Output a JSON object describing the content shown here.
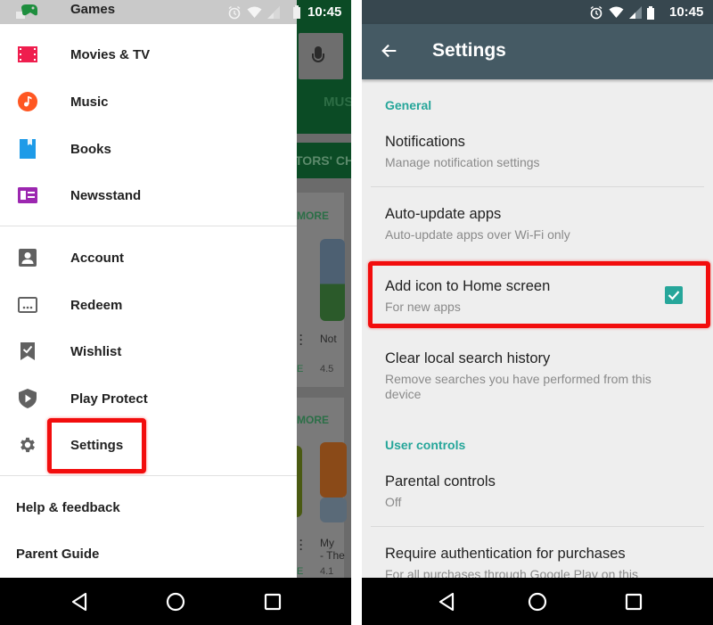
{
  "left_phone": {
    "status_bar": {
      "time": "10:45",
      "icons": [
        "alarm-icon",
        "wifi-icon",
        "signal-icon",
        "battery-icon"
      ]
    },
    "drawer": {
      "partial_item": {
        "label": "Games",
        "icon": "gamepad-icon",
        "icon_color": "#1e8e3e"
      },
      "apps": [
        {
          "label": "Movies & TV",
          "icon": "film-icon",
          "icon_color": "#ef1e4e"
        },
        {
          "label": "Music",
          "icon": "music-note-icon",
          "icon_color": "#ff5722"
        },
        {
          "label": "Books",
          "icon": "book-icon",
          "icon_color": "#1e9be8"
        },
        {
          "label": "Newsstand",
          "icon": "newsstand-icon",
          "icon_color": "#9c27b0"
        }
      ],
      "account_items": [
        {
          "label": "Account",
          "icon": "account-icon"
        },
        {
          "label": "Redeem",
          "icon": "redeem-icon"
        },
        {
          "label": "Wishlist",
          "icon": "wishlist-icon"
        },
        {
          "label": "Play Protect",
          "icon": "shield-play-icon"
        },
        {
          "label": "Settings",
          "icon": "gear-icon",
          "highlighted": true
        }
      ],
      "footer_items": [
        {
          "label": "Help & feedback"
        },
        {
          "label": "Parent Guide"
        }
      ],
      "icon_gray": "#616161"
    },
    "background_app": {
      "tab_partial": "MUS",
      "band_partial": "TORS' CH",
      "more_label": "MORE",
      "card1_title": "Not",
      "card1_rating": "4.5",
      "card1_price_partial": "E",
      "card2_title_line1": "My",
      "card2_title_line2": "- The",
      "card2_rating": "4.1",
      "card2_price_partial": "E"
    }
  },
  "right_phone": {
    "status_bar": {
      "time": "10:45",
      "icons": [
        "alarm-icon",
        "wifi-icon",
        "signal-icon",
        "battery-icon"
      ]
    },
    "toolbar": {
      "title": "Settings",
      "back_icon": "arrow-back-icon"
    },
    "sections": [
      {
        "header": "General",
        "items": [
          {
            "title": "Notifications",
            "summary": "Manage notification settings"
          },
          {
            "title": "Auto-update apps",
            "summary": "Auto-update apps over Wi-Fi only"
          },
          {
            "title": "Add icon to Home screen",
            "summary": "For new apps",
            "checkbox": true,
            "checked": true,
            "highlighted": true
          },
          {
            "title": "Clear local search history",
            "summary": "Remove searches you have performed from this device"
          }
        ]
      },
      {
        "header": "User controls",
        "items": [
          {
            "title": "Parental controls",
            "summary": "Off"
          },
          {
            "title": "Require authentication for purchases",
            "summary": "For all purchases through Google Play on this"
          }
        ]
      }
    ],
    "accent_color": "#26a69a",
    "toolbar_color": "#455a64"
  },
  "nav_bar": {
    "buttons": [
      "back-icon",
      "home-icon",
      "recents-icon"
    ]
  },
  "highlight_color": "#f20d0d"
}
